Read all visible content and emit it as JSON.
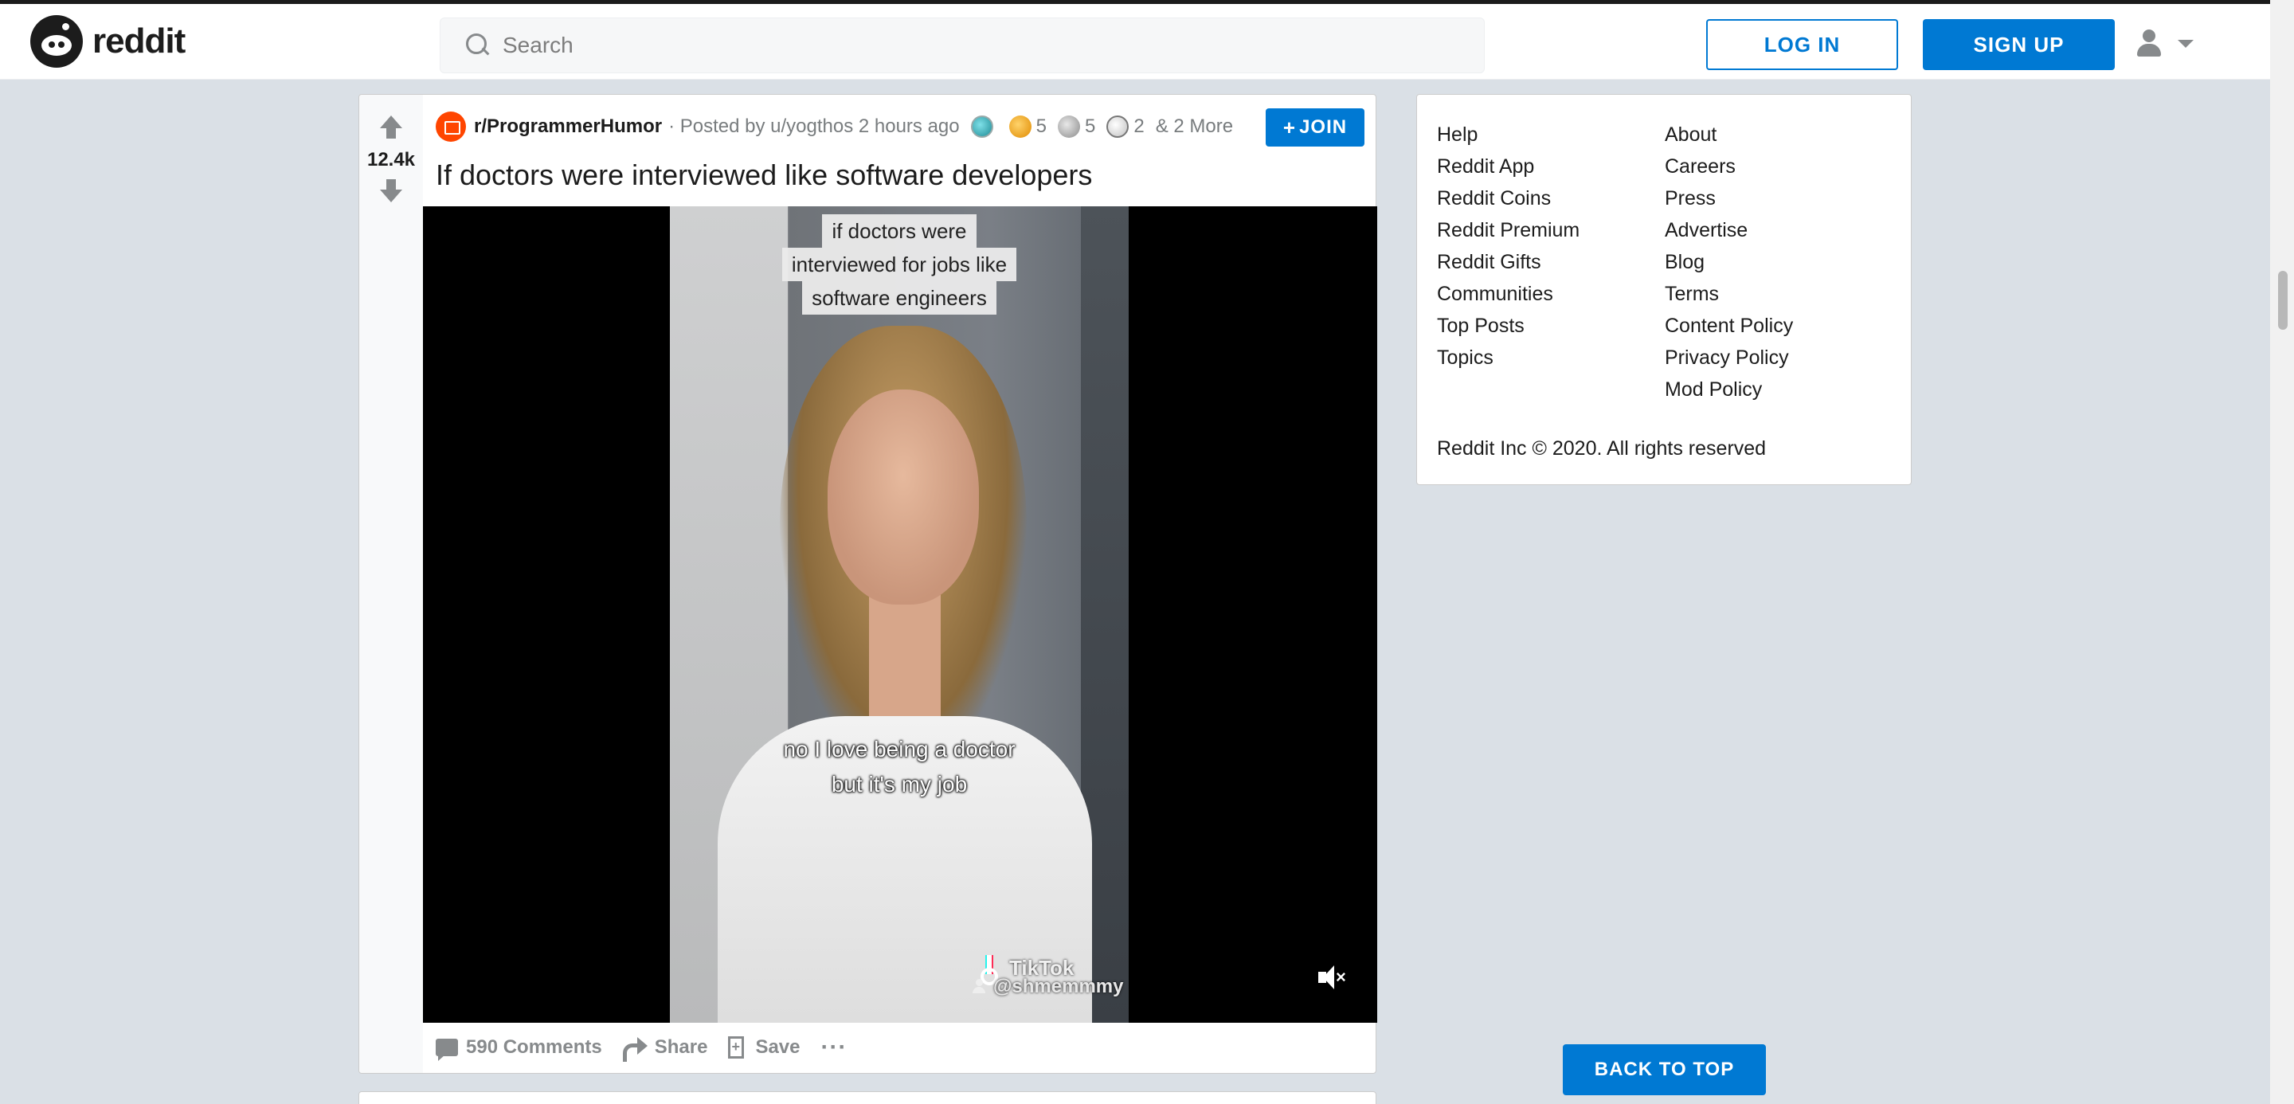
{
  "header": {
    "logo_text": "reddit",
    "search_placeholder": "Search",
    "login_label": "LOG IN",
    "signup_label": "SIGN UP"
  },
  "post": {
    "score": "12.4k",
    "subreddit": "r/ProgrammerHumor",
    "posted_by": "· Posted by u/yogthos 2 hours ago",
    "awards": [
      {
        "icon": "helpful-award-icon",
        "count": ""
      },
      {
        "icon": "wholesome-award-icon",
        "count": "5"
      },
      {
        "icon": "silver-award-icon",
        "count": "5"
      },
      {
        "icon": "doge-award-icon",
        "count": "2"
      }
    ],
    "more_awards": "& 2 More",
    "join_label": "JOIN",
    "title": "If doctors were interviewed like software developers",
    "video": {
      "caption_top": [
        "if doctors were",
        "interviewed for jobs like",
        "software engineers"
      ],
      "caption_bottom": [
        "no I love being a doctor",
        "but it's my job"
      ],
      "watermark": "TikTok",
      "handle": "@shmemmmy"
    },
    "actions": {
      "comments": "590 Comments",
      "share": "Share",
      "save": "Save",
      "more": "···"
    }
  },
  "sidebar": {
    "links_col1": [
      "Help",
      "Reddit App",
      "Reddit Coins",
      "Reddit Premium",
      "Reddit Gifts",
      "Communities",
      "Top Posts",
      "Topics"
    ],
    "links_col2": [
      "About",
      "Careers",
      "Press",
      "Advertise",
      "Blog",
      "Terms",
      "Content Policy",
      "Privacy Policy",
      "Mod Policy"
    ],
    "copyright": "Reddit Inc © 2020. All rights reserved"
  },
  "back_to_top": "BACK TO TOP",
  "colors": {
    "brand_blue": "#0079d3",
    "brand_orange": "#ff4500",
    "page_bg": "#dae0e6"
  }
}
